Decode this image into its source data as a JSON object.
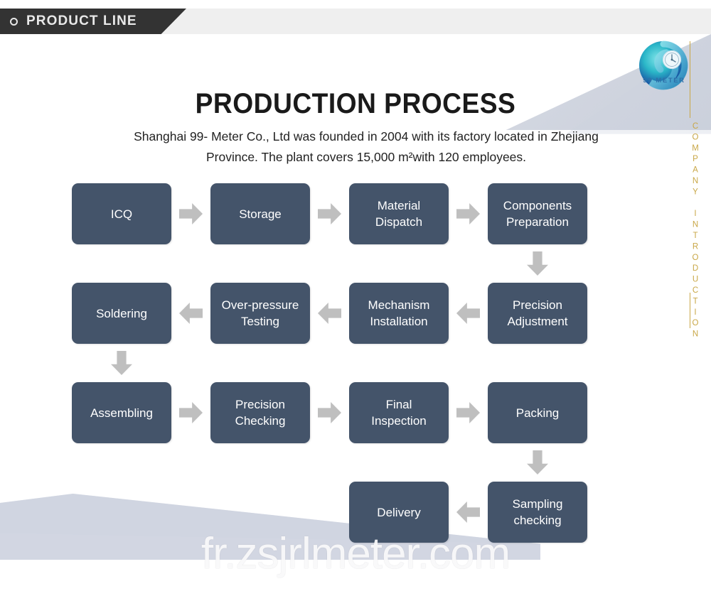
{
  "header": {
    "tab_label": "PRODUCT LINE",
    "bullet_icon": "circle-outline-icon"
  },
  "brand": {
    "logo_icon": "spiral-meter-logo-icon",
    "logo_text": "99 METER",
    "logo_color": "#2e6fa8"
  },
  "side": {
    "vertical_label": "COMPANY INTRODUCTION",
    "accent_color": "#c9a747"
  },
  "main": {
    "title": "PRODUCTION PROCESS",
    "description": "Shanghai 99- Meter Co., Ltd was founded in 2004 with its factory located in Zhejiang Province. The plant covers 15,000 m²with 120 employees."
  },
  "theme": {
    "box_color": "#44546a",
    "arrow_color": "#bfbfbf",
    "header_dark": "#333333",
    "header_light": "#efefef"
  },
  "flow": {
    "rows": [
      {
        "direction": "left-to-right",
        "steps": [
          {
            "label": "ICQ"
          },
          {
            "label": "Storage"
          },
          {
            "label": "Material\nDispatch",
            "line1": "Material",
            "line2": "Dispatch"
          },
          {
            "label": "Components\nPreparation",
            "line1": "Components",
            "line2": "Preparation"
          }
        ]
      },
      {
        "direction": "right-to-left",
        "steps": [
          {
            "label": "Soldering"
          },
          {
            "label": "Over-pressure\nTesting",
            "line1": "Over-pressure",
            "line2": "Testing"
          },
          {
            "label": "Mechanism\nInstallation",
            "line1": "Mechanism",
            "line2": "Installation"
          },
          {
            "label": "Precision\nAdjustment",
            "line1": "Precision",
            "line2": "Adjustment"
          }
        ]
      },
      {
        "direction": "left-to-right",
        "steps": [
          {
            "label": "Assembling"
          },
          {
            "label": "Precision\nChecking",
            "line1": "Precision",
            "line2": "Checking"
          },
          {
            "label": "Final\nInspection",
            "line1": "Final",
            "line2": "Inspection"
          },
          {
            "label": "Packing"
          }
        ]
      },
      {
        "direction": "right-to-left",
        "steps": [
          {
            "label": "Delivery"
          },
          {
            "label": "Sampling\nchecking",
            "line1": "Sampling",
            "line2": "checking"
          }
        ]
      }
    ],
    "connectors": [
      {
        "type": "down-arrow",
        "from": "Components Preparation",
        "to": "Precision Adjustment"
      },
      {
        "type": "down-arrow",
        "from": "Soldering",
        "to": "Assembling"
      },
      {
        "type": "down-arrow",
        "from": "Packing",
        "to": "Sampling checking"
      }
    ]
  },
  "watermark": {
    "text": "fr.zsjrlmeter.com"
  }
}
